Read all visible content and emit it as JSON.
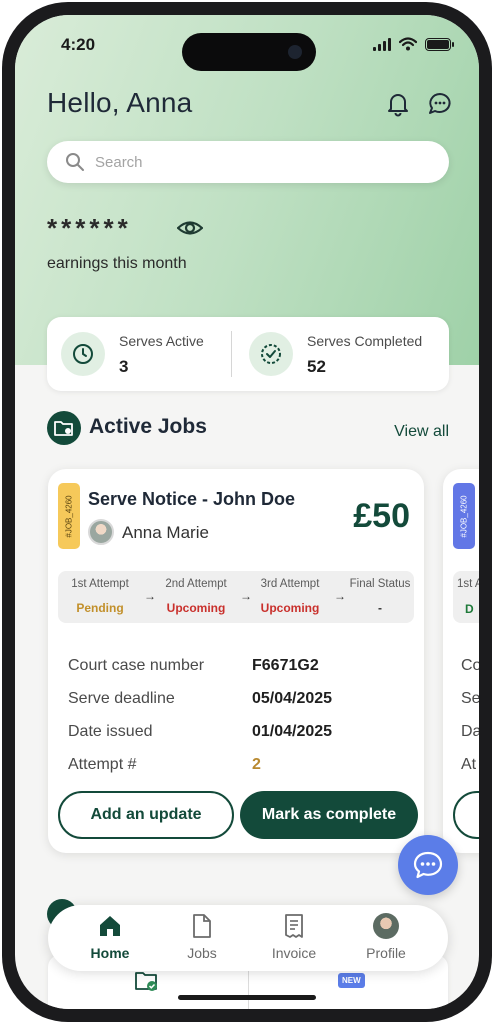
{
  "status_bar": {
    "time": "4:20"
  },
  "header": {
    "greeting": "Hello, Anna"
  },
  "search": {
    "placeholder": "Search"
  },
  "earnings": {
    "masked_value": "******",
    "label": "earnings this month"
  },
  "stats": [
    {
      "label": "Serves Active",
      "value": "3"
    },
    {
      "label": "Serves Completed",
      "value": "52"
    }
  ],
  "active_jobs": {
    "title": "Active Jobs",
    "view_all": "View all"
  },
  "job_card": {
    "job_id": "#JOB_4260",
    "title": "Serve Notice - John Doe",
    "price": "£50",
    "assignee": "Anna Marie",
    "attempts": [
      {
        "label": "1st Attempt",
        "status": "Pending",
        "color": "#c2902b"
      },
      {
        "label": "2nd Attempt",
        "status": "Upcoming",
        "color": "#c9302c"
      },
      {
        "label": "3rd Attempt",
        "status": "Upcoming",
        "color": "#c9302c"
      },
      {
        "label": "Final Status",
        "status": "-",
        "color": "#333333"
      }
    ],
    "arrow": "→",
    "details": [
      {
        "label": "Court case number",
        "value": "F6671G2"
      },
      {
        "label": "Serve deadline",
        "value": "05/04/2025"
      },
      {
        "label": "Date issued",
        "value": "01/04/2025"
      },
      {
        "label": "Attempt #",
        "value": "2",
        "color": "#b8892f"
      }
    ],
    "btn_update": "Add an update",
    "btn_complete": "Mark as complete"
  },
  "next_card": {
    "job_id": "#JOB_4260",
    "attempt_label": "1st A",
    "attempt_status": "D",
    "detail_prefixes": [
      "Co",
      "Se",
      "Da",
      "At"
    ]
  },
  "lower": {
    "badge": "NEW"
  },
  "nav": [
    {
      "label": "Home",
      "icon": "home-icon",
      "active": true
    },
    {
      "label": "Jobs",
      "icon": "document-icon",
      "active": false
    },
    {
      "label": "Invoice",
      "icon": "receipt-icon",
      "active": false
    },
    {
      "label": "Profile",
      "icon": "profile-avatar",
      "active": false
    }
  ],
  "colors": {
    "primary": "#134a3a",
    "accent_blue": "#5b7de8",
    "hero_green": "#bfe0c3",
    "pending": "#c2902b",
    "upcoming": "#c9302c"
  }
}
